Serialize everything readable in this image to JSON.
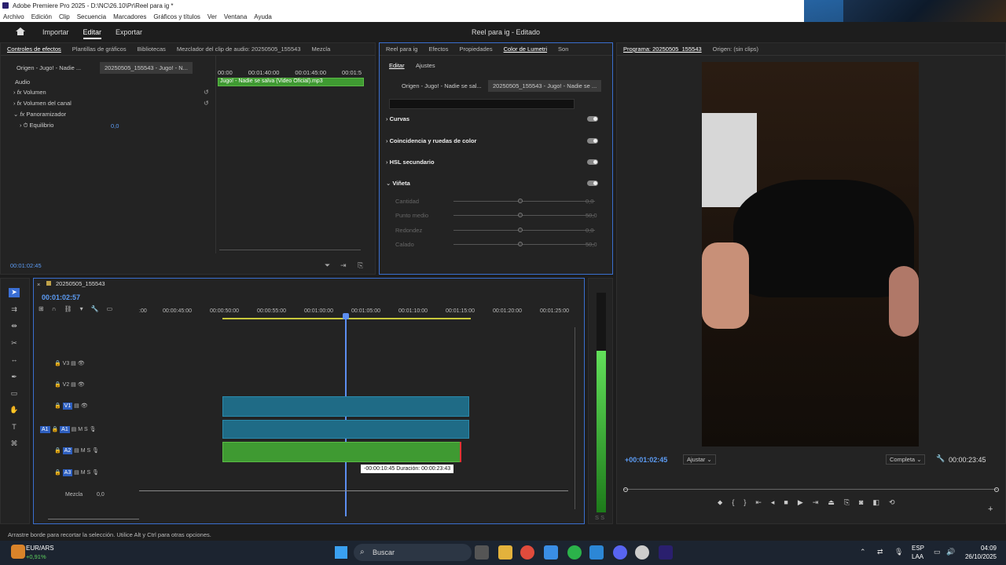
{
  "window": {
    "title": "Adobe Premiere Pro 2025 - D:\\NC\\26.10\\Pr\\Reel para ig *",
    "menu": [
      "Archivo",
      "Edición",
      "Clip",
      "Secuencia",
      "Marcadores",
      "Gráficos y títulos",
      "Ver",
      "Ventana",
      "Ayuda"
    ]
  },
  "header": {
    "nav": [
      "Importar",
      "Editar",
      "Exportar"
    ],
    "project_title": "Reel para ig - Editado"
  },
  "effect_controls": {
    "tabs": [
      "Controles de efectos",
      "Plantillas de gráficos",
      "Bibliotecas",
      "Mezclador del clip de audio: 20250505_155543",
      "Mezcla"
    ],
    "source_label": "Origen - Jugo! - Nadie ...",
    "seq_label": "20250505_155543 - Jugo! - N...",
    "section_audio": "Audio",
    "items": [
      "Volumen",
      "Volumen del canal",
      "Panoramizador"
    ],
    "sub_item": "Equilibrio",
    "sub_value": "0,0",
    "ruler": [
      "00:00",
      "00:01:40:00",
      "00:01:45:00",
      "00:01:5"
    ],
    "clip_name": "Jugo! - Nadie se salva (Video Oficial).mp3",
    "timecode": "00:01:02:45"
  },
  "lumetri": {
    "tabs": [
      "Reel para ig",
      "Efectos",
      "Propiedades",
      "Color de Lumetri",
      "Son"
    ],
    "subtabs": [
      "Editar",
      "Ajustes"
    ],
    "source_label": "Origen - Jugo! - Nadie se sal...",
    "seq_label": "20250505_155543 - Jugo! - Nadie se ...",
    "sections": [
      "Curvas",
      "Coincidencia y ruedas de color",
      "HSL secundario",
      "Viñeta"
    ],
    "vignette_params": [
      {
        "label": "Cantidad",
        "value": "0,0"
      },
      {
        "label": "Punto medio",
        "value": "50,0"
      },
      {
        "label": "Redondez",
        "value": "0,0"
      },
      {
        "label": "Calado",
        "value": "50,0"
      }
    ]
  },
  "program": {
    "tabs": [
      "Programa: 20250505_155543",
      "Origen: (sin clips)"
    ],
    "timecode": "+00:01:02:45",
    "fit": "Ajustar",
    "quality": "Completa",
    "duration": "00:00:23:45"
  },
  "timeline": {
    "sequence": "20250505_155543",
    "timecode": "00:01:02:57",
    "ruler": [
      ":00",
      "00:00:45:00",
      "00:00:50:00",
      "00:00:55:00",
      "00:01:00:00",
      "00:01:05:00",
      "00:01:10:00",
      "00:01:15:00",
      "00:01:20:00",
      "00:01:25:00"
    ],
    "tracks": [
      {
        "id": "V3"
      },
      {
        "id": "V2"
      },
      {
        "id": "V1"
      },
      {
        "id": "A1",
        "src": "A1"
      },
      {
        "id": "A2"
      },
      {
        "id": "A3"
      }
    ],
    "track_letters": [
      "M",
      "S"
    ],
    "mix_label": "Mezcla",
    "mix_value": "0,0",
    "tooltip": "-00:00:10:45 Duración: 00:00:23:43",
    "meter_labels": "S S"
  },
  "status_bar": "Arrastre borde para recortar la selección. Utilice Alt y Ctrl para otras opciones.",
  "taskbar": {
    "stock": "EUR/ARS",
    "stock_change": "+0,91%",
    "search": "Buscar",
    "lang": "ESP",
    "lang2": "LAA",
    "time": "04:09",
    "date": "26/10/2025"
  }
}
